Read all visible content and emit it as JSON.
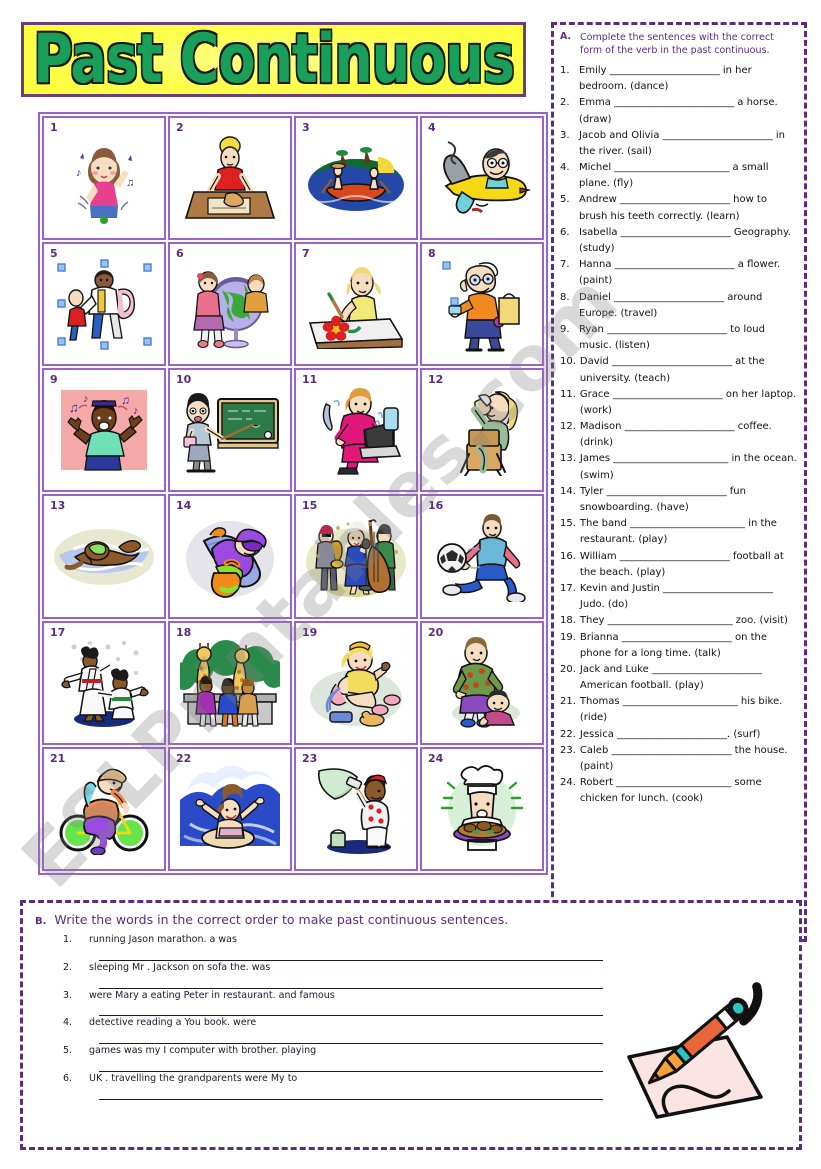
{
  "title": {
    "text": "Past Continuous",
    "banner_bg": "#fdfd3a",
    "text_color": "#18a05a",
    "border_color": "#6b3f7a"
  },
  "watermark": {
    "text": "ESLPrintables.com"
  },
  "picture_grid": {
    "border_color": "#9a63c9",
    "cells": [
      {
        "number": "1",
        "art": "dancing-girl"
      },
      {
        "number": "2",
        "art": "drawing-woman"
      },
      {
        "number": "3",
        "art": "sailing-boat"
      },
      {
        "number": "4",
        "art": "flying-plane"
      },
      {
        "number": "5",
        "art": "brushing-teeth"
      },
      {
        "number": "6",
        "art": "globe-geography"
      },
      {
        "number": "7",
        "art": "painting-flower"
      },
      {
        "number": "8",
        "art": "traveller-suitcase"
      },
      {
        "number": "9",
        "art": "listening-music"
      },
      {
        "number": "10",
        "art": "teacher-blackboard"
      },
      {
        "number": "11",
        "art": "woman-laptop"
      },
      {
        "number": "12",
        "art": "drinking-coffee"
      },
      {
        "number": "13",
        "art": "swimmer"
      },
      {
        "number": "14",
        "art": "snowboarder"
      },
      {
        "number": "15",
        "art": "band-playing"
      },
      {
        "number": "16",
        "art": "football-kick"
      },
      {
        "number": "17",
        "art": "judo-fighters"
      },
      {
        "number": "18",
        "art": "zoo-giraffes"
      },
      {
        "number": "19",
        "art": "talking-phone"
      },
      {
        "number": "20",
        "art": "american-football"
      },
      {
        "number": "21",
        "art": "riding-bike"
      },
      {
        "number": "22",
        "art": "surfing-wave"
      },
      {
        "number": "23",
        "art": "painting-house"
      },
      {
        "number": "24",
        "art": "chef-cooking"
      }
    ]
  },
  "exercise_a": {
    "letter": "A.",
    "instruction": "Complete the sentences with the correct form of the verb in the past continuous.",
    "items": [
      {
        "num": "1.",
        "text": "Emily ______________________ in her bedroom. (dance)"
      },
      {
        "num": "2.",
        "text": "Emma ________________________ a horse. (draw)"
      },
      {
        "num": "3.",
        "text": "Jacob and Olivia ______________________ in the river. (sail)"
      },
      {
        "num": "4.",
        "text": "Michel _______________________ a small plane. (fly)"
      },
      {
        "num": "5.",
        "text": "Andrew ______________________ how to brush his teeth correctly. (learn)"
      },
      {
        "num": "6.",
        "text": "Isabella ______________________ Geography. (study)"
      },
      {
        "num": "7.",
        "text": "Hanna ________________________ a flower. (paint)"
      },
      {
        "num": "8.",
        "text": "Daniel ______________________ around Europe. (travel)"
      },
      {
        "num": "9.",
        "text": "Ryan ________________________ to loud music. (listen)"
      },
      {
        "num": "10.",
        "text": "David ________________________ at the university. (teach)"
      },
      {
        "num": "11.",
        "text": "Grace ______________________ on her laptop. (work)"
      },
      {
        "num": "12.",
        "text": "Madison ______________________ coffee. (drink)"
      },
      {
        "num": "13.",
        "text": "James _______________________ in the ocean. (swim)"
      },
      {
        "num": "14.",
        "text": "Tyler ________________________ fun snowboarding. (have)"
      },
      {
        "num": "15.",
        "text": "The band _______________________ in the restaurant. (play)"
      },
      {
        "num": "16.",
        "text": "William ______________________ football at the beach. (play)"
      },
      {
        "num": "17.",
        "text": "Kevin and Justin ______________________ Judo. (do)"
      },
      {
        "num": "18.",
        "text": "They _________________________ zoo. (visit)"
      },
      {
        "num": "19.",
        "text": "Brianna ______________________ on the phone for a long time. (talk)"
      },
      {
        "num": "20.",
        "text": "Jack and Luke ______________________ American football. (play)"
      },
      {
        "num": "21.",
        "text": "Thomas _______________________ his bike. (ride)"
      },
      {
        "num": "22.",
        "text": "Jessica ______________________. (surf)"
      },
      {
        "num": "23.",
        "text": "Caleb ________________________ the house. (paint)"
      },
      {
        "num": "24.",
        "text": "Robert _______________________ some chicken for lunch. (cook)"
      }
    ]
  },
  "exercise_b": {
    "letter": "B.",
    "instruction": "Write the words in the correct order to make past continuous sentences.",
    "items": [
      {
        "num": "1.",
        "words": "running Jason marathon. a was"
      },
      {
        "num": "2.",
        "words": "sleeping Mr . Jackson on sofa the. was"
      },
      {
        "num": "3.",
        "words": "were Mary a eating  Peter in restaurant. and famous"
      },
      {
        "num": "4.",
        "words": "detective reading a You book. were"
      },
      {
        "num": "5.",
        "words": "games was my I computer with brother. playing"
      },
      {
        "num": "6.",
        "words": "UK . travelling the grandparents were My to"
      }
    ]
  },
  "pen_illustration": {
    "name": "pen-writing-on-paper",
    "paper_color": "#fbe4e4",
    "pen_body_color": "#f6a13c",
    "pen_accent_color": "#e8663c"
  }
}
